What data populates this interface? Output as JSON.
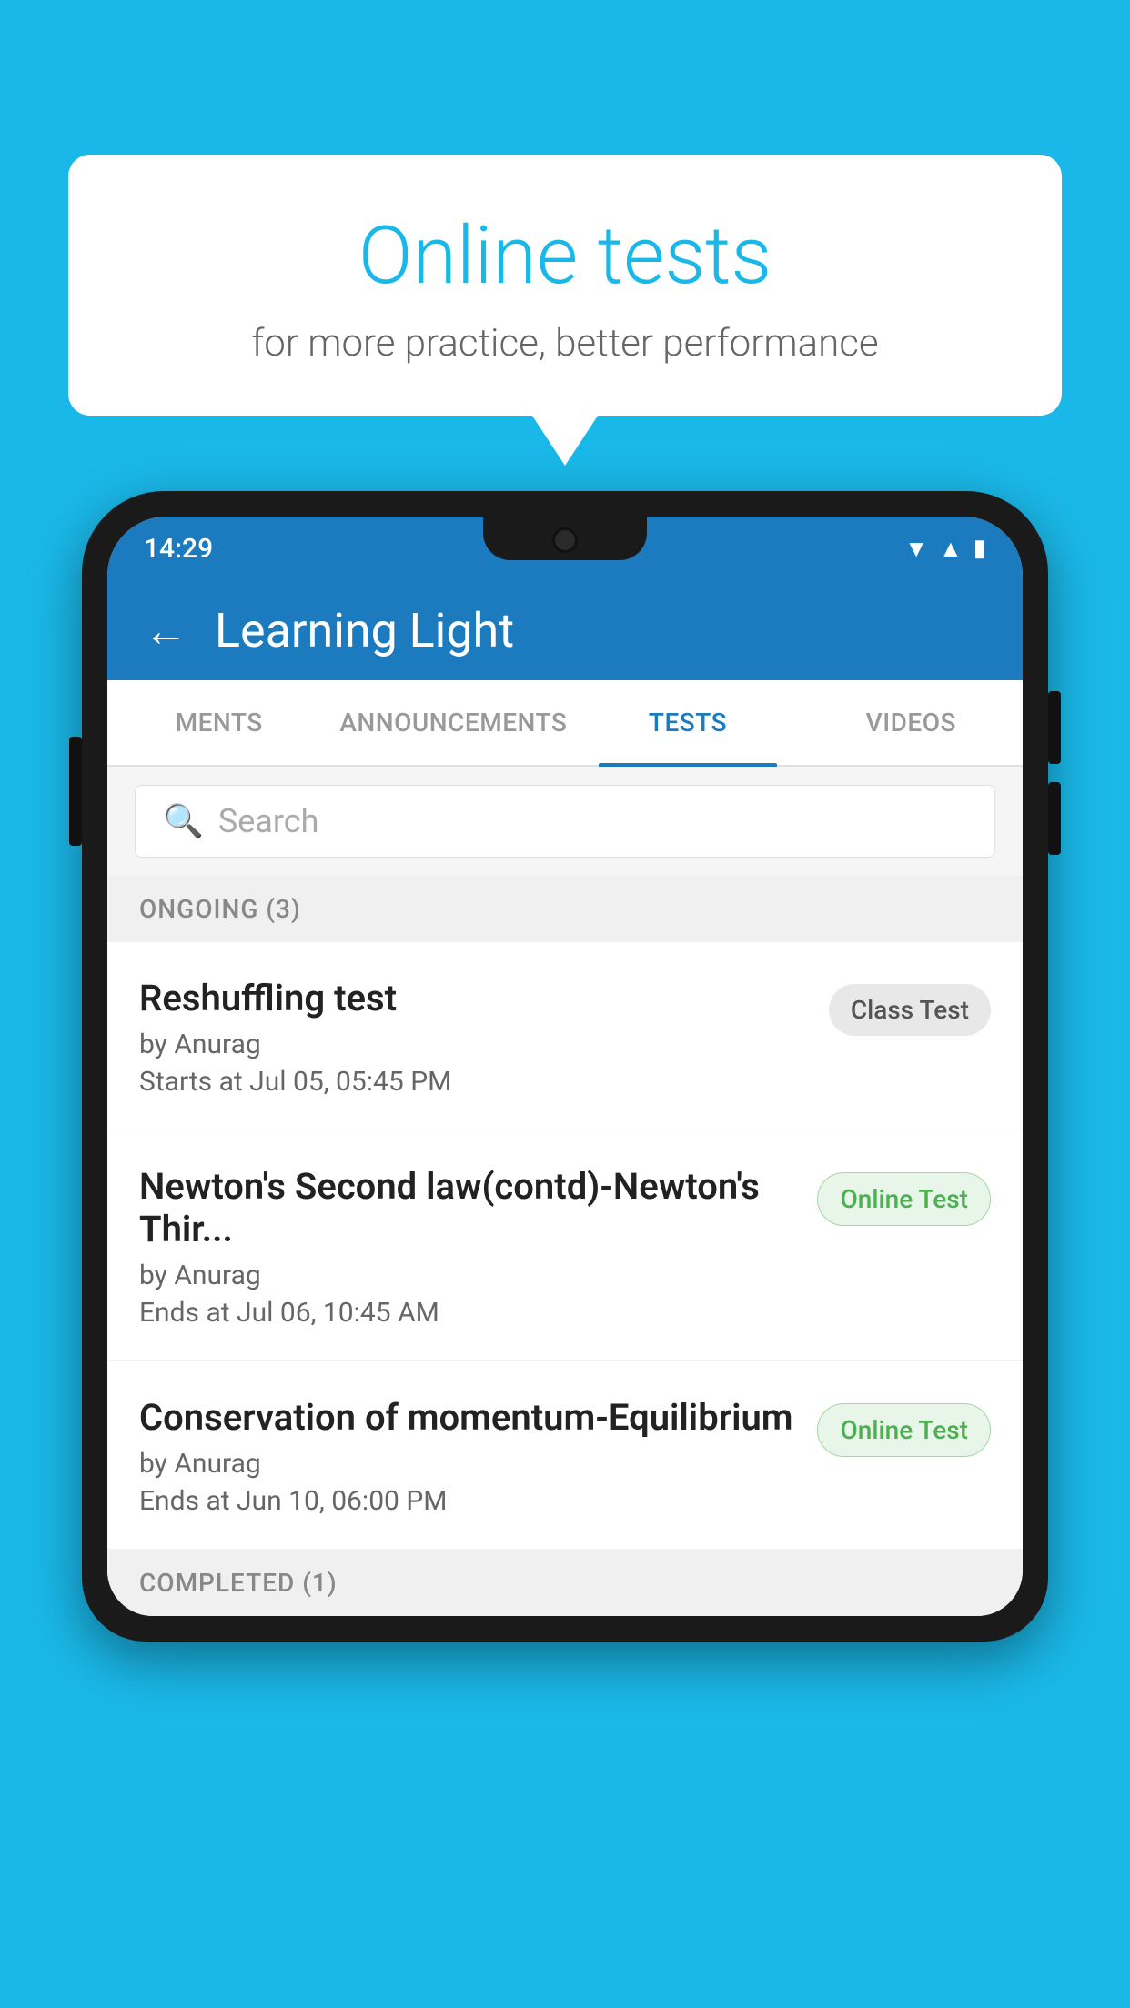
{
  "background": {
    "color": "#1ab8e8"
  },
  "speech_bubble": {
    "title": "Online tests",
    "subtitle": "for more practice, better performance"
  },
  "phone": {
    "status_bar": {
      "time": "14:29",
      "icons": [
        "wifi",
        "signal",
        "battery"
      ]
    },
    "app_bar": {
      "title": "Learning Light",
      "back_label": "←"
    },
    "tabs": [
      {
        "label": "MENTS",
        "active": false
      },
      {
        "label": "ANNOUNCEMENTS",
        "active": false
      },
      {
        "label": "TESTS",
        "active": true
      },
      {
        "label": "VIDEOS",
        "active": false
      }
    ],
    "search": {
      "placeholder": "Search"
    },
    "sections": [
      {
        "header": "ONGOING (3)",
        "items": [
          {
            "title": "Reshuffling test",
            "author": "by Anurag",
            "date": "Starts at  Jul 05, 05:45 PM",
            "badge_text": "Class Test",
            "badge_type": "class"
          },
          {
            "title": "Newton's Second law(contd)-Newton's Thir...",
            "author": "by Anurag",
            "date": "Ends at  Jul 06, 10:45 AM",
            "badge_text": "Online Test",
            "badge_type": "online"
          },
          {
            "title": "Conservation of momentum-Equilibrium",
            "author": "by Anurag",
            "date": "Ends at  Jun 10, 06:00 PM",
            "badge_text": "Online Test",
            "badge_type": "online"
          }
        ]
      }
    ],
    "completed_section": {
      "header": "COMPLETED (1)"
    }
  }
}
